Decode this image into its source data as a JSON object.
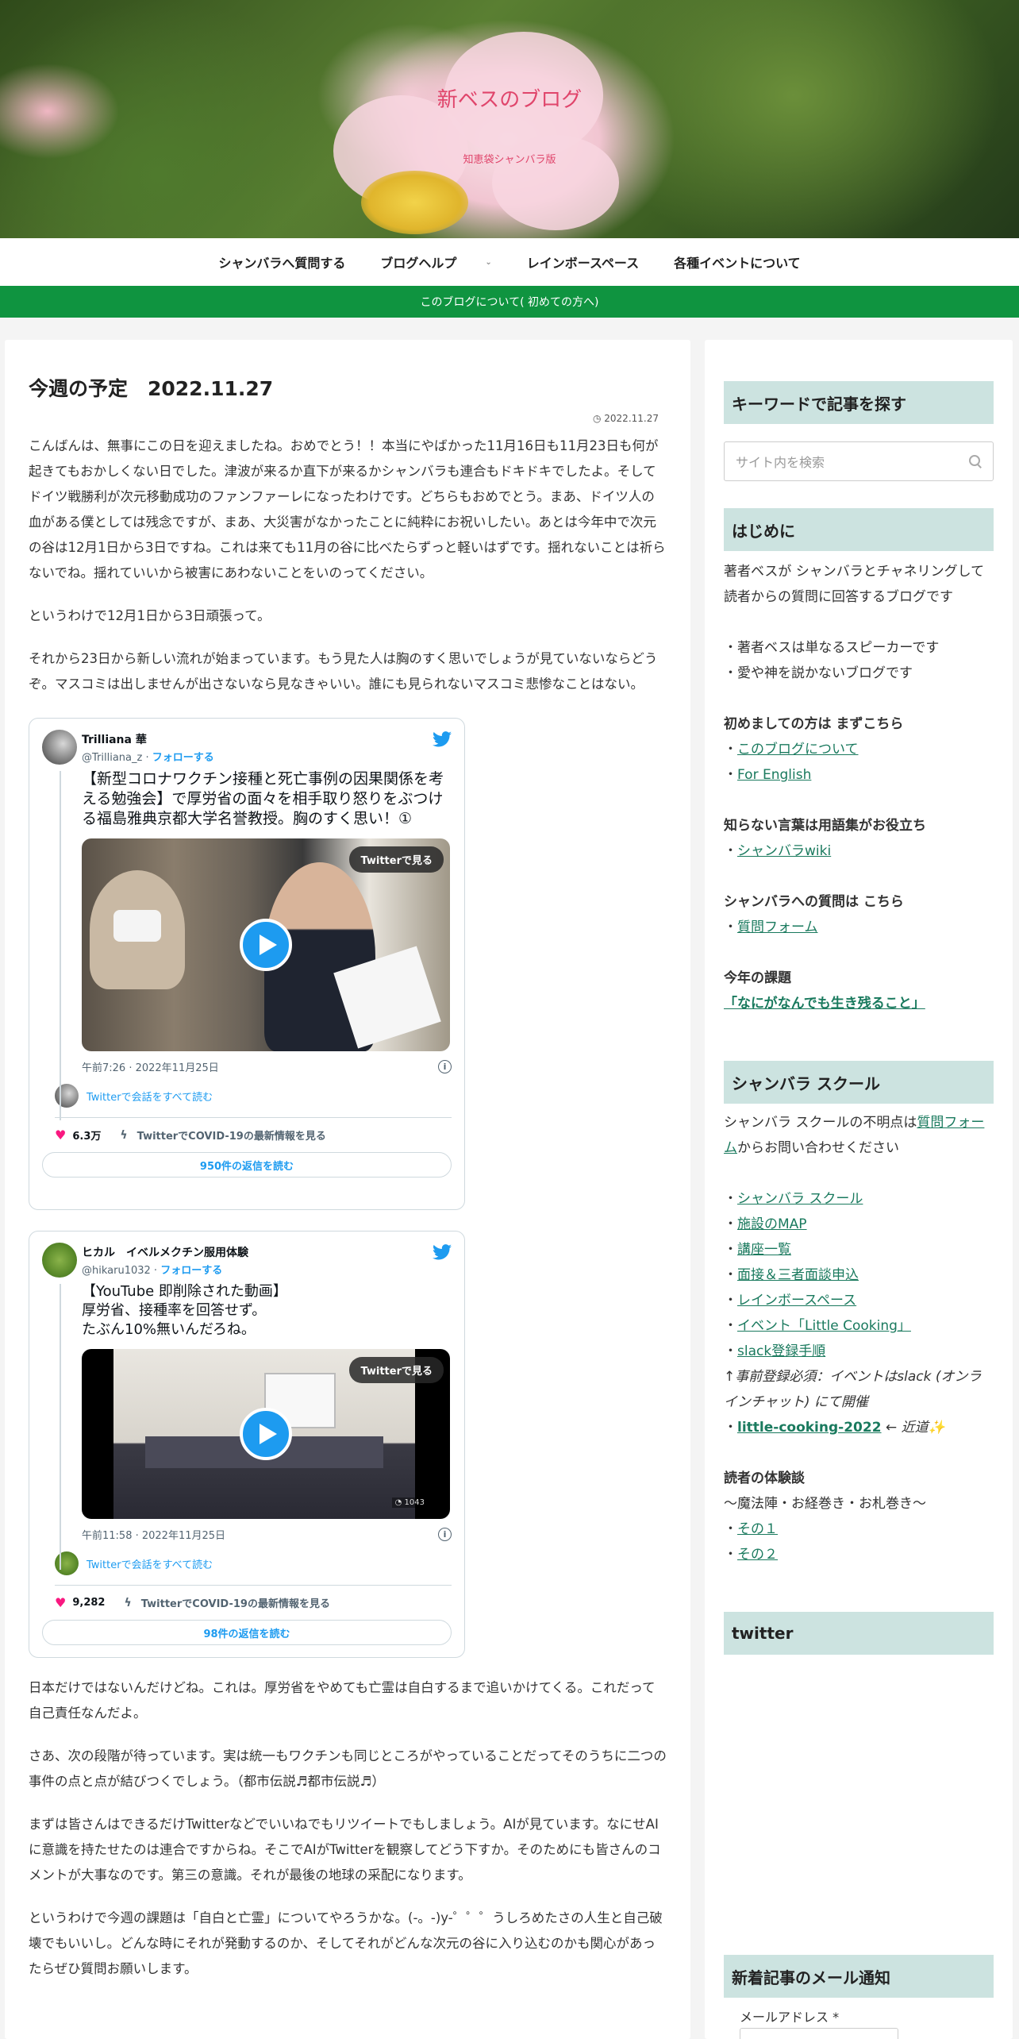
{
  "site": {
    "title": "新ベスのブログ",
    "description": "知恵袋シャンバラ版"
  },
  "nav": {
    "items": [
      "シャンバラへ質問する",
      "ブログヘルプ",
      "レインボースペース",
      "各種イベントについて"
    ]
  },
  "notice": "このブログについて( 初めての方へ)",
  "post": {
    "title": "今週の予定　2022.11.27",
    "date": "2022.11.27",
    "paragraphs_before": [
      "こんばんは、無事にこの日を迎えましたね。おめでとう！！本当にやばかった11月16日も11月23日も何が起きてもおかしくない日でした。津波が来るか直下が来るかシャンバラも連合もドキドキでしたよ。そしてドイツ戦勝利が次元移動成功のファンファーレになったわけです。どちらもおめでとう。まあ、ドイツ人の血がある僕としては残念ですが、まあ、大災害がなかったことに純粋にお祝いしたい。あとは今年中で次元の谷は12月1日から3日ですね。これは来ても11月の谷に比べたらずっと軽いはずです。揺れないことは祈らないでね。揺れていいから被害にあわないことをいのってください。",
      "というわけで12月1日から3日頑張って。",
      "それから23日から新しい流れが始まっています。もう見た人は胸のすく思いでしょうが見ていないならどうぞ。マスコミは出しませんが出さないなら見なきゃいい。誰にも見られないマスコミ悲惨なことはない。"
    ],
    "paragraphs_after": [
      "日本だけではないんだけどね。これは。厚労省をやめても亡霊は自白するまで追いかけてくる。これだって自己責任なんだよ。",
      "さあ、次の段階が待っています。実は統一もワクチンも同じところがやっていることだってそのうちに二つの事件の点と点が結びつくでしょう。（都市伝説♬都市伝説♬）",
      "まずは皆さんはできるだけTwitterなどでいいねでもリツイートでもしましょう。AIが見ています。なにせAIに意識を持たせたのは連合ですからね。そこでAIがTwitterを観察してどう下すか。そのためにも皆さんのコメントが大事なのです。第三の意識。それが最後の地球の采配になります。",
      "というわけで今週の課題は「自白と亡霊」についてやろうかな。(-。-)y-゜゜゜うしろめたさの人生と自己破壊でもいいし。どんな時にそれが発動するのか、そしてそれがどんな次元の谷に入り込むのかも関心があったらぜひ質問お願いします。"
    ]
  },
  "tweets": [
    {
      "name": "Trilliana 華",
      "handle": "@Trilliana_z",
      "follow": "フォローする",
      "text": "【新型コロナワクチン接種と死亡事例の因果関係を考える勉強会】で厚労省の面々を相手取り怒りをぶつける福島雅典京都大学名誉教授。胸のすく思い！①",
      "watch": "Twitterで見る",
      "time": "午前7:26 · 2022年11月25日",
      "thread": "Twitterで会話をすべて読む",
      "likes": "6.3万",
      "topic": "TwitterでCOVID-19の最新情報を見る",
      "replies": "950件の返信を読む",
      "views": ""
    },
    {
      "name": "ヒカル　イベルメクチン服用体験",
      "handle": "@hikaru1032",
      "follow": "フォローする",
      "text": "【YouTube 即削除された動画】\n厚労省、接種率を回答せず。\nたぶん10%無いんだろね。",
      "watch": "Twitterで見る",
      "time": "午前11:58 · 2022年11月25日",
      "thread": "Twitterで会話をすべて読む",
      "likes": "9,282",
      "topic": "TwitterでCOVID-19の最新情報を見る",
      "replies": "98件の返信を読む",
      "views": "1043"
    }
  ],
  "sidebar": {
    "search": {
      "heading": "キーワードで記事を探す",
      "placeholder": "サイト内を検索"
    },
    "intro": {
      "heading": "はじめに",
      "desc": "著者ベスが シャンバラとチャネリングして 読者からの質問に回答するブログです",
      "bullet1": "・著者ベスは単なるスピーカーです",
      "bullet2": "・愛や神を説かないブログです",
      "first_label": "初めましての方は まずこちら",
      "link_about": "このブログについて",
      "link_english": "For English",
      "glossary_label": "知らない言葉は用語集がお役立ち",
      "link_wiki": "シャンバラwiki",
      "question_label": "シャンバラへの質問は こちら",
      "link_form": "質問フォーム",
      "theme_label": "今年の課題",
      "theme_link": "「なにがなんでも生き残ること」"
    },
    "school": {
      "heading": "シャンバラ スクール",
      "desc_pre": "シャンバラ スクールの不明点は",
      "desc_link": "質問フォーム",
      "desc_post": "からお問い合わせください",
      "links": [
        "シャンバラ スクール",
        "施設のMAP",
        "講座一覧",
        "面接＆三者面談申込",
        "レインボースペース",
        "イベント「Little Cooking」",
        "slack登録手順"
      ],
      "note": "↑事前登録必須：イベントはslack (オンラインチャット) にて開催",
      "cooking_link": "little-cooking-2022",
      "cooking_suffix": " ← 近道✨",
      "reviews_label": "読者の体験談",
      "reviews_sub": "〜魔法陣・お経巻き・お札巻き〜",
      "review_links": [
        "その１",
        "その２"
      ]
    },
    "twitter": {
      "heading": "twitter"
    },
    "mail": {
      "heading": "新着記事のメール通知",
      "email_label": "メールアドレス *"
    }
  },
  "colors": {
    "accent_green": "#0f9440",
    "sidebar_heading_bg": "#cce3e0",
    "title_pink": "#e0456b",
    "twitter_blue": "#1d9bf0"
  }
}
